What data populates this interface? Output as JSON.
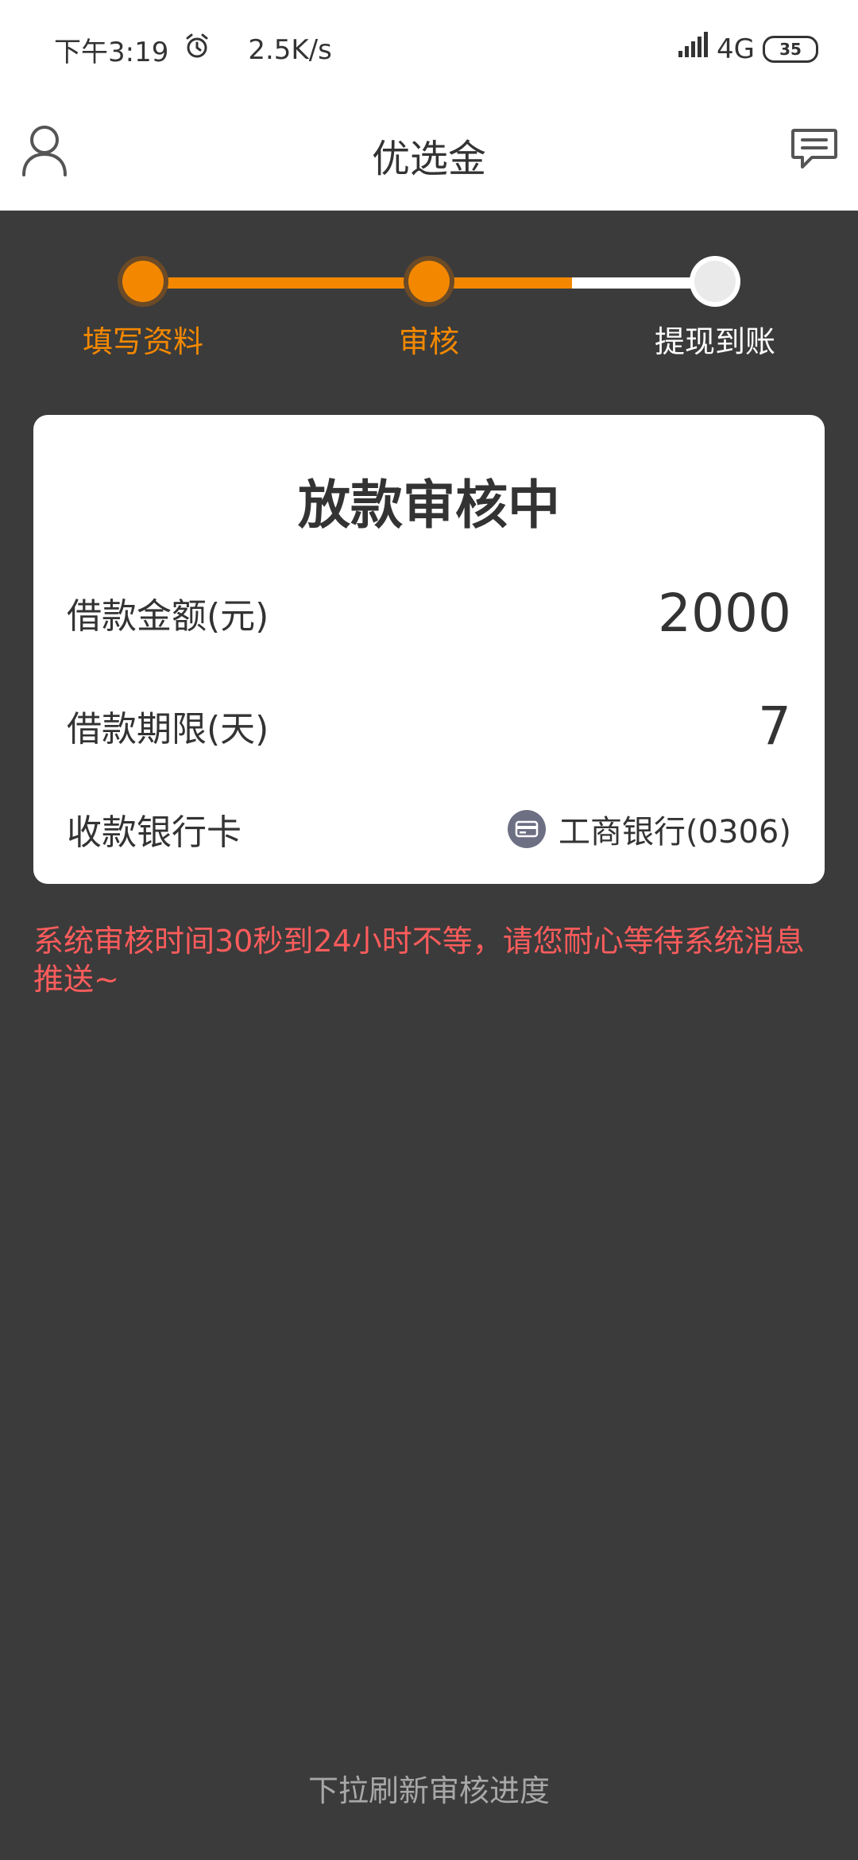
{
  "status_bar": {
    "time": "下午3:19",
    "speed": "2.5K/s",
    "network": "4G",
    "battery": "35"
  },
  "header": {
    "title": "优选金"
  },
  "steps": [
    {
      "label": "填写资料",
      "state": "done"
    },
    {
      "label": "审核",
      "state": "current"
    },
    {
      "label": "提现到账",
      "state": "pending"
    }
  ],
  "card": {
    "title": "放款审核中",
    "loan_amount_label": "借款金额(元)",
    "loan_amount_value": "2000",
    "loan_term_label": "借款期限(天)",
    "loan_term_value": "7",
    "bank_label": "收款银行卡",
    "bank_value": "工商银行(0306)"
  },
  "notice": "系统审核时间30秒到24小时不等，请您耐心等待系统消息推送~",
  "pull_hint": "下拉刷新审核进度",
  "colors": {
    "accent": "#f38800",
    "warning": "#ff5c5c",
    "background": "#3b3b3b"
  }
}
